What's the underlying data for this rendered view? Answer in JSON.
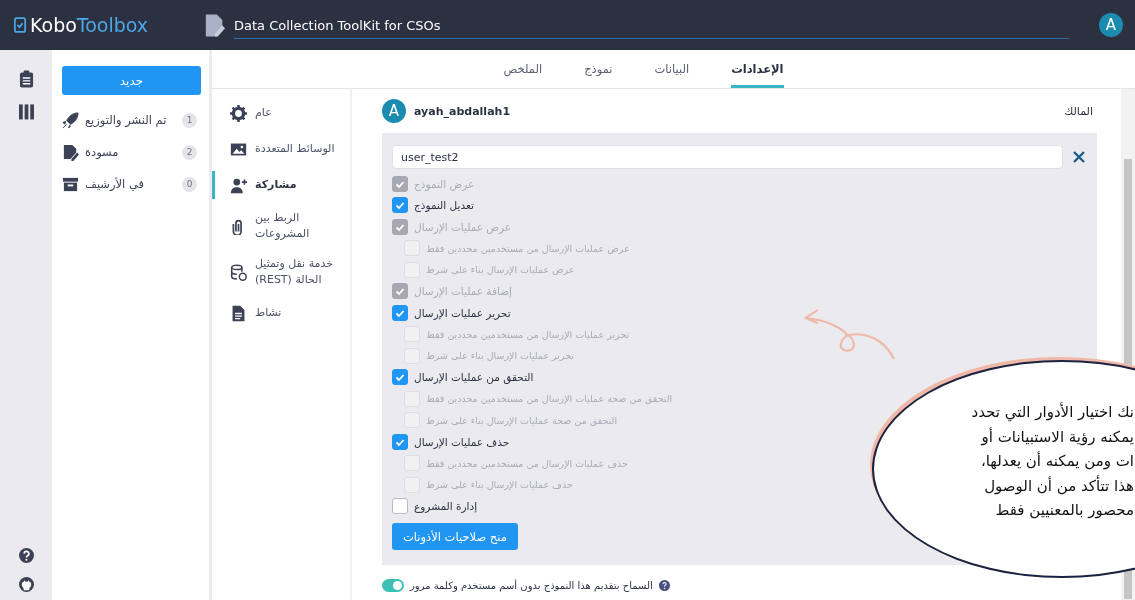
{
  "header": {
    "logo_part_1": "Kobo",
    "logo_part_2": "Toolbox",
    "project_title": "Data Collection ToolKit for CSOs",
    "avatar_letter": "A"
  },
  "sidebar": {
    "new_button": "جديد",
    "items": [
      {
        "label": "تم النشر والتوزيع",
        "count": "1"
      },
      {
        "label": "مسودة",
        "count": "2"
      },
      {
        "label": "في الأرشيف",
        "count": "0"
      }
    ]
  },
  "tabs": [
    {
      "label": "الإعدادات",
      "selected": true
    },
    {
      "label": "البيانات",
      "selected": false
    },
    {
      "label": "نموذج",
      "selected": false
    },
    {
      "label": "الملخص",
      "selected": false
    }
  ],
  "settings_nav": [
    {
      "label": "عام",
      "selected": false
    },
    {
      "label": "الوسائط المتعددة",
      "selected": false
    },
    {
      "label": "مشاركة",
      "selected": true
    },
    {
      "label": "الربط بين المشروعات",
      "selected": false
    },
    {
      "label": "خدمة نقل وتمثيل الحالة (REST)",
      "selected": false
    },
    {
      "label": "نشاط",
      "selected": false
    }
  ],
  "owner": {
    "avatar_letter": "A",
    "username": "ayah_abdallah1",
    "role": "المالك"
  },
  "user_field": {
    "value": "user_test2"
  },
  "permissions": [
    {
      "kind": "main",
      "label": "عرض النموذج",
      "checked": true,
      "disabled": true
    },
    {
      "kind": "main",
      "label": "تعديل النموذج",
      "checked": true,
      "disabled": false
    },
    {
      "kind": "main",
      "label": "عرض عمليات الإرسال",
      "checked": true,
      "disabled": true
    },
    {
      "kind": "sub",
      "label": "عرض عمليات الإرسال من مستخدمين محددين فقط",
      "checked": false,
      "disabled": true
    },
    {
      "kind": "sub",
      "label": "عرض عمليات الإرسال بناء على شرط",
      "checked": false,
      "disabled": true
    },
    {
      "kind": "main",
      "label": "إضافة عمليات الإرسال",
      "checked": true,
      "disabled": true
    },
    {
      "kind": "main",
      "label": "تحرير عمليات الإرسال",
      "checked": true,
      "disabled": false
    },
    {
      "kind": "sub",
      "label": "تحرير عمليات الإرسال من مستخدمين محددين فقط",
      "checked": false,
      "disabled": true
    },
    {
      "kind": "sub",
      "label": "تحرير عمليات الإرسال بناء على شرط",
      "checked": false,
      "disabled": true
    },
    {
      "kind": "main",
      "label": "التحقق من عمليات الإرسال",
      "checked": true,
      "disabled": false
    },
    {
      "kind": "sub",
      "label": "التحقق من صحة عمليات الإرسال من مستخدمين محددين فقط",
      "checked": false,
      "disabled": true
    },
    {
      "kind": "sub",
      "label": "التحقق من صحة عمليات الإرسال بناء على شرط",
      "checked": false,
      "disabled": true
    },
    {
      "kind": "main",
      "label": "حذف عمليات الإرسال",
      "checked": true,
      "disabled": false
    },
    {
      "kind": "sub",
      "label": "حذف عمليات الإرسال من مستخدمين محددين فقط",
      "checked": false,
      "disabled": true
    },
    {
      "kind": "sub",
      "label": "حذف عمليات الإرسال بناء على شرط",
      "checked": false,
      "disabled": true
    },
    {
      "kind": "main",
      "label": "إدارة المشروع",
      "checked": false,
      "disabled": false
    }
  ],
  "grant_button": "منح صلاحيات الأذونات",
  "anonymous_toggle": {
    "label": "السماح بتقديم هذا النموذج بدون أسم مستخدم وكلمة مرور",
    "on": true
  },
  "callout": {
    "lines": [
      "نك اختيار الأدوار التي تحدد",
      "يمكنه رؤية الاستبيانات أو",
      "ات ومن يمكنه أن يعدلها،",
      "هذا تتأكد من أن الوصول",
      "محصور بالمعنيين فقط"
    ]
  }
}
